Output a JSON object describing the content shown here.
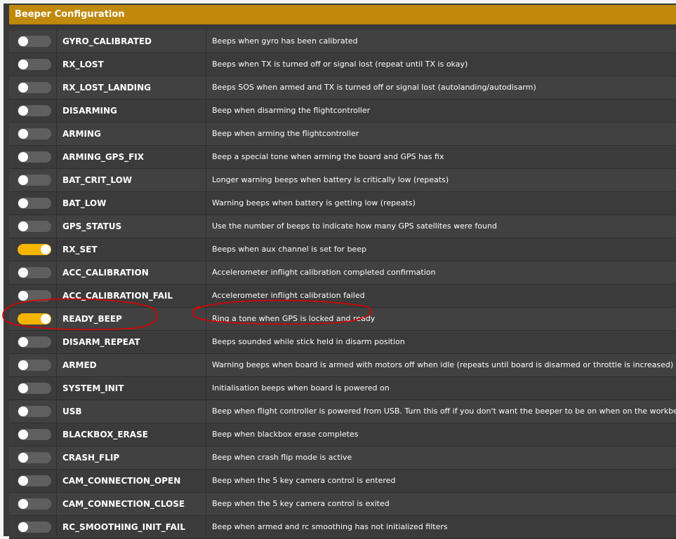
{
  "header": {
    "title": "Beeper Configuration"
  },
  "colors": {
    "accent": "#c1890b",
    "toggle_on": "#f6b500",
    "toggle_off": "#5f5f5f",
    "annotation": "#e00000"
  },
  "beepers": [
    {
      "name": "GYRO_CALIBRATED",
      "description": "Beeps when gyro has been calibrated",
      "enabled": false
    },
    {
      "name": "RX_LOST",
      "description": "Beeps when TX is turned off or signal lost (repeat until TX is okay)",
      "enabled": false
    },
    {
      "name": "RX_LOST_LANDING",
      "description": "Beeps SOS when armed and TX is turned off or signal lost (autolanding/autodisarm)",
      "enabled": false
    },
    {
      "name": "DISARMING",
      "description": "Beep when disarming the flightcontroller",
      "enabled": false
    },
    {
      "name": "ARMING",
      "description": "Beep when arming the flightcontroller",
      "enabled": false
    },
    {
      "name": "ARMING_GPS_FIX",
      "description": "Beep a special tone when arming the board and GPS has fix",
      "enabled": false
    },
    {
      "name": "BAT_CRIT_LOW",
      "description": "Longer warning beeps when battery is critically low (repeats)",
      "enabled": false
    },
    {
      "name": "BAT_LOW",
      "description": "Warning beeps when battery is getting low (repeats)",
      "enabled": false
    },
    {
      "name": "GPS_STATUS",
      "description": "Use the number of beeps to indicate how many GPS satellites were found",
      "enabled": false
    },
    {
      "name": "RX_SET",
      "description": "Beeps when aux channel is set for beep",
      "enabled": true
    },
    {
      "name": "ACC_CALIBRATION",
      "description": "Accelerometer inflight calibration completed confirmation",
      "enabled": false
    },
    {
      "name": "ACC_CALIBRATION_FAIL",
      "description": "Accelerometer inflight calibration failed",
      "enabled": false
    },
    {
      "name": "READY_BEEP",
      "description": "Ring a tone when GPS is locked and ready",
      "enabled": true
    },
    {
      "name": "DISARM_REPEAT",
      "description": "Beeps sounded while stick held in disarm position",
      "enabled": false
    },
    {
      "name": "ARMED",
      "description": "Warning beeps when board is armed with motors off when idle (repeats until board is disarmed or throttle is increased)",
      "enabled": false
    },
    {
      "name": "SYSTEM_INIT",
      "description": "Initialisation beeps when board is powered on",
      "enabled": false
    },
    {
      "name": "USB",
      "description": "Beep when flight controller is powered from USB. Turn this off if you don't want the beeper to be on when on the workbench",
      "enabled": false
    },
    {
      "name": "BLACKBOX_ERASE",
      "description": "Beep when blackbox erase completes",
      "enabled": false
    },
    {
      "name": "CRASH_FLIP",
      "description": "Beep when crash flip mode is active",
      "enabled": false
    },
    {
      "name": "CAM_CONNECTION_OPEN",
      "description": "Beep when the 5 key camera control is entered",
      "enabled": false
    },
    {
      "name": "CAM_CONNECTION_CLOSE",
      "description": "Beep when the 5 key camera control is exited",
      "enabled": false
    },
    {
      "name": "RC_SMOOTHING_INIT_FAIL",
      "description": "Beep when armed and rc smoothing has not initialized filters",
      "enabled": false
    }
  ]
}
